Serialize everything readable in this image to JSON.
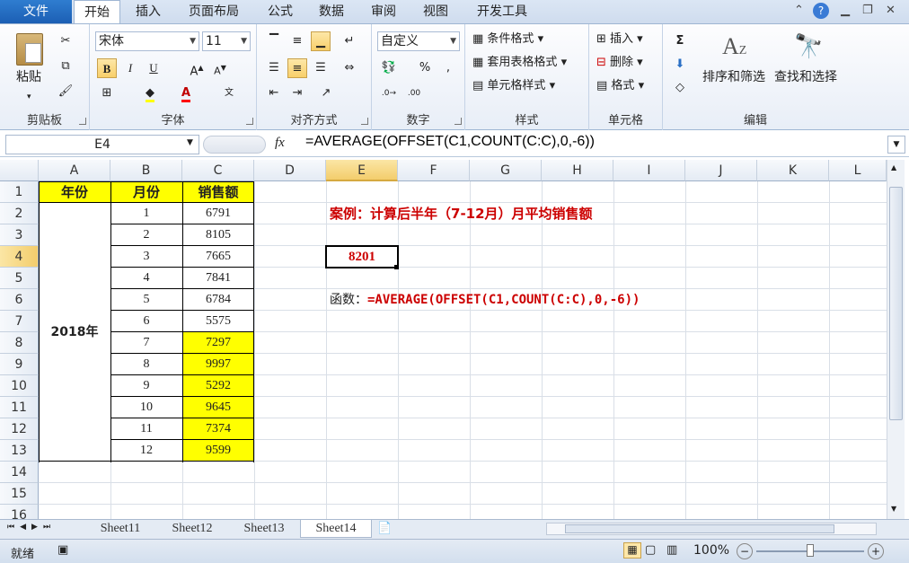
{
  "tabs": {
    "file": "文件",
    "home": "开始",
    "insert": "插入",
    "layout": "页面布局",
    "formulas": "公式",
    "data": "数据",
    "review": "审阅",
    "view": "视图",
    "developer": "开发工具"
  },
  "ribbon": {
    "clipboard": {
      "label": "剪贴板",
      "paste": "粘贴"
    },
    "font": {
      "label": "字体",
      "name": "宋体",
      "size": "11",
      "bold": "B",
      "italic": "I",
      "underline": "U"
    },
    "alignment": {
      "label": "对齐方式"
    },
    "number": {
      "label": "数字",
      "format": "自定义",
      "percent": "%",
      "comma": ","
    },
    "styles": {
      "label": "样式",
      "conditional": "条件格式",
      "table_fmt": "套用表格格式",
      "cell_styles": "单元格样式"
    },
    "cells": {
      "label": "单元格",
      "insert": "插入",
      "delete": "删除",
      "format": "格式"
    },
    "editing": {
      "label": "编辑",
      "sort_filter": "排序和筛选",
      "find_select": "查找和选择",
      "sigma": "Σ"
    }
  },
  "formula_bar": {
    "name_box": "E4",
    "fx": "fx",
    "formula": "=AVERAGE(OFFSET(C1,COUNT(C:C),0,-6))"
  },
  "columns": [
    "A",
    "B",
    "C",
    "D",
    "E",
    "F",
    "G",
    "H",
    "I",
    "J",
    "K",
    "L"
  ],
  "rows": [
    "1",
    "2",
    "3",
    "4",
    "5",
    "6",
    "7",
    "8",
    "9",
    "10",
    "11",
    "12",
    "13",
    "14",
    "15",
    "16"
  ],
  "table": {
    "headers": {
      "year": "年份",
      "month": "月份",
      "sales": "销售额"
    },
    "year": "2018年",
    "months": [
      "1",
      "2",
      "3",
      "4",
      "5",
      "6",
      "7",
      "8",
      "9",
      "10",
      "11",
      "12"
    ],
    "sales": [
      "6791",
      "8105",
      "7665",
      "7841",
      "6784",
      "5575",
      "7297",
      "9997",
      "5292",
      "9645",
      "7374",
      "9599"
    ]
  },
  "notes": {
    "title": "案例：计算后半年（7-12月）月平均销售额",
    "result": "8201",
    "func_label": "函数：",
    "func_text": "=AVERAGE(OFFSET(C1,COUNT(C:C),0,-6))"
  },
  "sheets": [
    "Sheet11",
    "Sheet12",
    "Sheet13",
    "Sheet14"
  ],
  "status": {
    "ready": "就绪",
    "zoom": "100%"
  },
  "colors": {
    "highlight": "#ffff00",
    "red_text": "#cc0000",
    "ribbon_tab_file": "#2a6fc5"
  }
}
